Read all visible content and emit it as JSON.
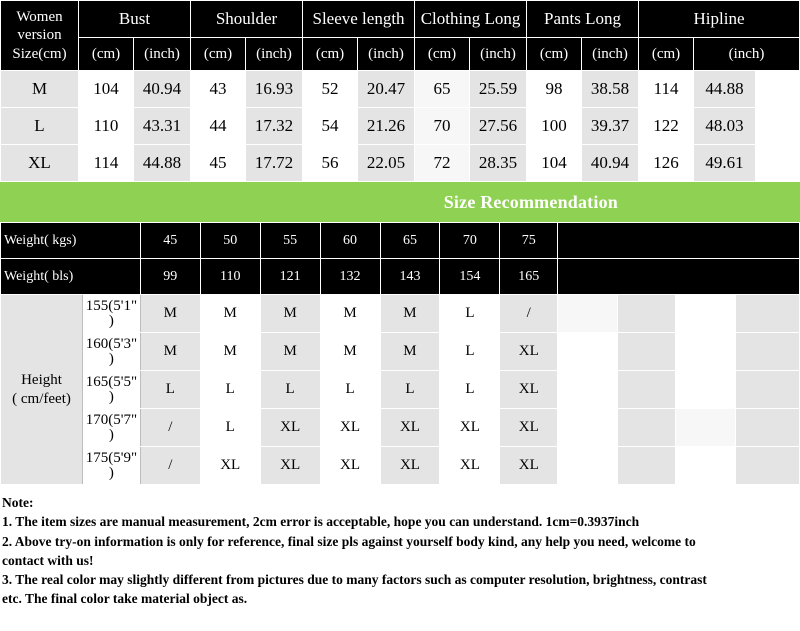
{
  "table": {
    "corner_label": "Women version Size(cm)",
    "corner_lines": [
      "Women",
      "version",
      "Size(cm)"
    ],
    "groups": [
      {
        "name": "Bust"
      },
      {
        "name": "Shoulder"
      },
      {
        "name": "Sleeve length"
      },
      {
        "name": "Clothing Long"
      },
      {
        "name": "Pants Long"
      },
      {
        "name": "Hipline"
      }
    ],
    "unit_cm": "(cm)",
    "unit_inch": "(inch)",
    "rows": [
      {
        "size": "M",
        "values": [
          "104",
          "40.94",
          "43",
          "16.93",
          "52",
          "20.47",
          "65",
          "25.59",
          "98",
          "38.58",
          "114",
          "44.88"
        ]
      },
      {
        "size": "L",
        "values": [
          "110",
          "43.31",
          "44",
          "17.32",
          "54",
          "21.26",
          "70",
          "27.56",
          "100",
          "39.37",
          "122",
          "48.03"
        ]
      },
      {
        "size": "XL",
        "values": [
          "114",
          "44.88",
          "45",
          "17.72",
          "56",
          "22.05",
          "72",
          "28.35",
          "104",
          "40.94",
          "126",
          "49.61"
        ]
      }
    ]
  },
  "recommendation": {
    "banner_title": "Size Recommendation",
    "banner_color": "#8fd152",
    "weight_kgs_label": "Weight( kgs)",
    "weight_kgs": [
      "45",
      "50",
      "55",
      "60",
      "65",
      "70",
      "75"
    ],
    "weight_lbs_label": "Weight( bls)",
    "weight_lbs": [
      "99",
      "110",
      "121",
      "132",
      "143",
      "154",
      "165"
    ],
    "height_side_label_line1": "Height",
    "height_side_label_line2": "( cm/feet)",
    "height_rows": [
      {
        "label_l1": "155(5'1\"",
        "label_l2": ")",
        "cells": [
          "M",
          "M",
          "M",
          "M",
          "M",
          "L",
          "/"
        ]
      },
      {
        "label_l1": "160(5'3\"",
        "label_l2": ")",
        "cells": [
          "M",
          "M",
          "M",
          "M",
          "M",
          "L",
          "XL"
        ]
      },
      {
        "label_l1": "165(5'5\"",
        "label_l2": ")",
        "cells": [
          "L",
          "L",
          "L",
          "L",
          "L",
          "L",
          "XL"
        ]
      },
      {
        "label_l1": "170(5'7\"",
        "label_l2": ")",
        "cells": [
          "/",
          "L",
          "XL",
          "XL",
          "XL",
          "XL",
          "XL"
        ]
      },
      {
        "label_l1": "175(5'9\"",
        "label_l2": ")",
        "cells": [
          "/",
          "XL",
          "XL",
          "XL",
          "XL",
          "XL",
          "XL"
        ]
      }
    ],
    "empty_cell": ""
  },
  "note": {
    "heading": "Note:",
    "lines": [
      "1. The item sizes are manual measurement, 2cm error is acceptable, hope you can understand. 1cm=0.3937inch",
      "2. Above try-on information is only for reference, final size pls against yourself body kind, any help you need, welcome to",
      "contact with us!",
      "3. The real color may slightly different from pictures due to many factors such as computer resolution, brightness, contrast",
      "etc. The final color take material object as."
    ]
  }
}
